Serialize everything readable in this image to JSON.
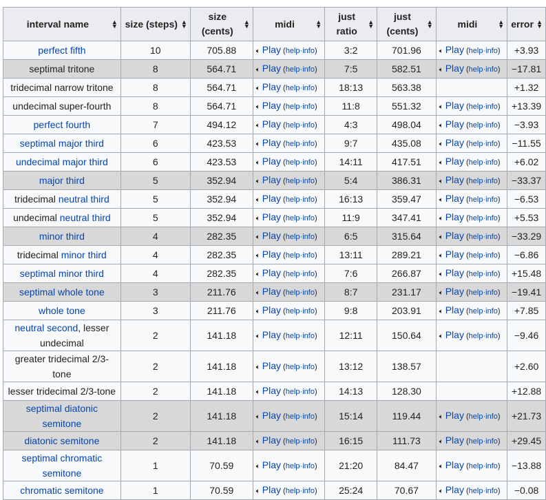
{
  "headers": [
    {
      "label": "interval name"
    },
    {
      "label": "size (steps)"
    },
    {
      "label": "size (cents)"
    },
    {
      "label": "midi"
    },
    {
      "label": "just ratio"
    },
    {
      "label": "just (cents)"
    },
    {
      "label": "midi"
    },
    {
      "label": "error"
    }
  ],
  "play": {
    "label": "Play",
    "help": "help",
    "info": "info",
    "sep": "·",
    "icon": "speaker-icon"
  },
  "colors": {
    "link": "#0645ad",
    "header_bg": "#eaecf0",
    "highlight": "#d8d8d8"
  },
  "rows": [
    {
      "name": [
        {
          "t": "perfect fifth",
          "link": true
        }
      ],
      "steps": "10",
      "cents": "705.88",
      "ratio": "3:2",
      "jcents": "701.96",
      "midi2": true,
      "error": "+3.93",
      "hl": false
    },
    {
      "name": [
        {
          "t": "septimal tritone",
          "link": false
        }
      ],
      "steps": "8",
      "cents": "564.71",
      "ratio": "7:5",
      "jcents": "582.51",
      "midi2": true,
      "error": "−17.81",
      "hl": true
    },
    {
      "name": [
        {
          "t": "tridecimal narrow tritone",
          "link": false
        }
      ],
      "steps": "8",
      "cents": "564.71",
      "ratio": "18:13",
      "jcents": "563.38",
      "midi2": false,
      "error": "+1.32",
      "hl": false
    },
    {
      "name": [
        {
          "t": "undecimal super-fourth",
          "link": false
        }
      ],
      "steps": "8",
      "cents": "564.71",
      "ratio": "11:8",
      "jcents": "551.32",
      "midi2": true,
      "error": "+13.39",
      "hl": false
    },
    {
      "name": [
        {
          "t": "perfect fourth",
          "link": true
        }
      ],
      "steps": "7",
      "cents": "494.12",
      "ratio": "4:3",
      "jcents": "498.04",
      "midi2": true,
      "error": "−3.93",
      "hl": false
    },
    {
      "name": [
        {
          "t": "septimal major third",
          "link": true
        }
      ],
      "steps": "6",
      "cents": "423.53",
      "ratio": "9:7",
      "jcents": "435.08",
      "midi2": true,
      "error": "−11.55",
      "hl": false
    },
    {
      "name": [
        {
          "t": "undecimal major third",
          "link": true
        }
      ],
      "steps": "6",
      "cents": "423.53",
      "ratio": "14:11",
      "jcents": "417.51",
      "midi2": true,
      "error": "+6.02",
      "hl": false
    },
    {
      "name": [
        {
          "t": "major third",
          "link": true
        }
      ],
      "steps": "5",
      "cents": "352.94",
      "ratio": "5:4",
      "jcents": "386.31",
      "midi2": true,
      "error": "−33.37",
      "hl": true
    },
    {
      "name": [
        {
          "t": "tridecimal ",
          "link": false
        },
        {
          "t": "neutral third",
          "link": true
        }
      ],
      "steps": "5",
      "cents": "352.94",
      "ratio": "16:13",
      "jcents": "359.47",
      "midi2": true,
      "error": "−6.53",
      "hl": false
    },
    {
      "name": [
        {
          "t": "undecimal ",
          "link": false
        },
        {
          "t": "neutral third",
          "link": true
        }
      ],
      "steps": "5",
      "cents": "352.94",
      "ratio": "11:9",
      "jcents": "347.41",
      "midi2": true,
      "error": "+5.53",
      "hl": false
    },
    {
      "name": [
        {
          "t": "minor third",
          "link": true
        }
      ],
      "steps": "4",
      "cents": "282.35",
      "ratio": "6:5",
      "jcents": "315.64",
      "midi2": true,
      "error": "−33.29",
      "hl": true
    },
    {
      "name": [
        {
          "t": "tridecimal ",
          "link": false
        },
        {
          "t": "minor third",
          "link": true
        }
      ],
      "steps": "4",
      "cents": "282.35",
      "ratio": "13:11",
      "jcents": "289.21",
      "midi2": true,
      "error": "−6.86",
      "hl": false
    },
    {
      "name": [
        {
          "t": "septimal minor third",
          "link": true
        }
      ],
      "steps": "4",
      "cents": "282.35",
      "ratio": "7:6",
      "jcents": "266.87",
      "midi2": true,
      "error": "+15.48",
      "hl": false
    },
    {
      "name": [
        {
          "t": "septimal whole tone",
          "link": true
        }
      ],
      "steps": "3",
      "cents": "211.76",
      "ratio": "8:7",
      "jcents": "231.17",
      "midi2": true,
      "error": "−19.41",
      "hl": true
    },
    {
      "name": [
        {
          "t": "whole tone",
          "link": true
        }
      ],
      "steps": "3",
      "cents": "211.76",
      "ratio": "9:8",
      "jcents": "203.91",
      "midi2": true,
      "error": "+7.85",
      "hl": false
    },
    {
      "name": [
        {
          "t": "neutral second",
          "link": true
        },
        {
          "t": ", lesser undecimal",
          "link": false
        }
      ],
      "steps": "2",
      "cents": "141.18",
      "ratio": "12:11",
      "jcents": "150.64",
      "midi2": true,
      "error": "−9.46",
      "hl": false,
      "tall": true
    },
    {
      "name": [
        {
          "t": "greater tridecimal 2/3-tone",
          "link": false
        }
      ],
      "steps": "2",
      "cents": "141.18",
      "ratio": "13:12",
      "jcents": "138.57",
      "midi2": false,
      "error": "+2.60",
      "hl": false
    },
    {
      "name": [
        {
          "t": "lesser tridecimal 2/3-tone",
          "link": false
        }
      ],
      "steps": "2",
      "cents": "141.18",
      "ratio": "14:13",
      "jcents": "128.30",
      "midi2": false,
      "error": "+12.88",
      "hl": false
    },
    {
      "name": [
        {
          "t": "septimal diatonic semitone",
          "link": true
        }
      ],
      "steps": "2",
      "cents": "141.18",
      "ratio": "15:14",
      "jcents": "119.44",
      "midi2": true,
      "error": "+21.73",
      "hl": true
    },
    {
      "name": [
        {
          "t": "diatonic semitone",
          "link": true
        }
      ],
      "steps": "2",
      "cents": "141.18",
      "ratio": "16:15",
      "jcents": "111.73",
      "midi2": true,
      "error": "+29.45",
      "hl": true
    },
    {
      "name": [
        {
          "t": "septimal chromatic semitone",
          "link": true
        }
      ],
      "steps": "1",
      "cents": "70.59",
      "ratio": "21:20",
      "jcents": "84.47",
      "midi2": true,
      "error": "−13.88",
      "hl": false,
      "tall": true
    },
    {
      "name": [
        {
          "t": "chromatic semitone",
          "link": true
        }
      ],
      "steps": "1",
      "cents": "70.59",
      "ratio": "25:24",
      "jcents": "70.67",
      "midi2": true,
      "error": "−0.08",
      "hl": false
    }
  ]
}
